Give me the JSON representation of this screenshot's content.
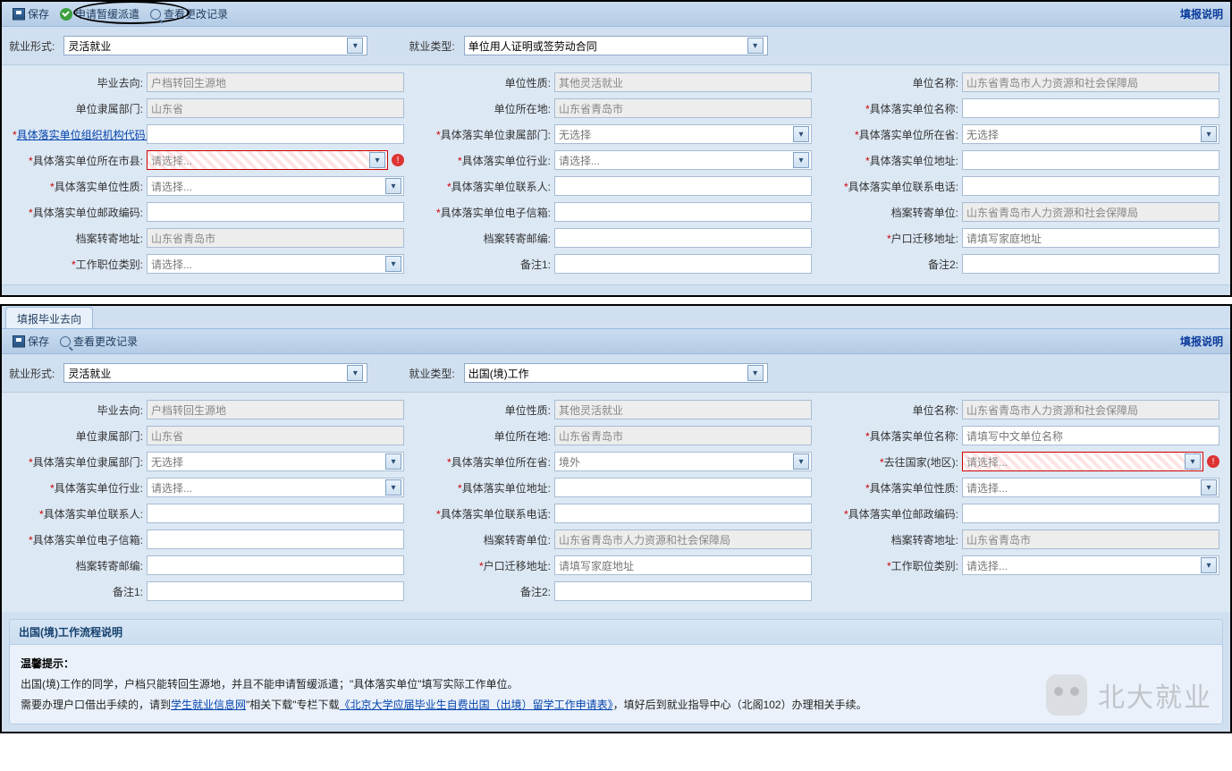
{
  "panel1": {
    "toolbar": {
      "save": "保存",
      "apply": "申请暂缓派遣",
      "view": "查看更改记录",
      "help": "填报说明"
    },
    "top": {
      "form_label": "就业形式:",
      "form_value": "灵活就业",
      "type_label": "就业类型:",
      "type_value": "单位用人证明或签劳动合同"
    },
    "rows": [
      {
        "a": {
          "label": "毕业去向:",
          "value": "户档转回生源地",
          "readonly": true
        },
        "b": {
          "label": "单位性质:",
          "value": "其他灵活就业",
          "readonly": true
        },
        "c": {
          "label": "单位名称:",
          "value": "山东省青岛市人力资源和社会保障局",
          "readonly": true
        }
      },
      {
        "a": {
          "label": "单位隶属部门:",
          "value": "山东省",
          "readonly": true
        },
        "b": {
          "label": "单位所在地:",
          "value": "山东省青岛市",
          "readonly": true
        },
        "c": {
          "label": "具体落实单位名称:",
          "required": true,
          "value": ""
        }
      },
      {
        "a": {
          "label": "具体落实单位组织机构代码:",
          "link": true,
          "required": true,
          "value": ""
        },
        "b": {
          "label": "具体落实单位隶属部门:",
          "required": true,
          "value": "无选择",
          "dropdown": true
        },
        "c": {
          "label": "具体落实单位所在省:",
          "required": true,
          "value": "无选择",
          "dropdown": true
        }
      },
      {
        "a": {
          "label": "具体落实单位所在市县:",
          "required": true,
          "value": "请选择...",
          "dropdown": true,
          "error": true
        },
        "b": {
          "label": "具体落实单位行业:",
          "required": true,
          "value": "请选择...",
          "dropdown": true
        },
        "c": {
          "label": "具体落实单位地址:",
          "required": true,
          "value": ""
        }
      },
      {
        "a": {
          "label": "具体落实单位性质:",
          "required": true,
          "value": "请选择...",
          "dropdown": true
        },
        "b": {
          "label": "具体落实单位联系人:",
          "required": true,
          "value": ""
        },
        "c": {
          "label": "具体落实单位联系电话:",
          "required": true,
          "value": ""
        }
      },
      {
        "a": {
          "label": "具体落实单位邮政编码:",
          "required": true,
          "value": ""
        },
        "b": {
          "label": "具体落实单位电子信箱:",
          "required": true,
          "value": ""
        },
        "c": {
          "label": "档案转寄单位:",
          "value": "山东省青岛市人力资源和社会保障局",
          "readonly": true
        }
      },
      {
        "a": {
          "label": "档案转寄地址:",
          "value": "山东省青岛市",
          "readonly": true
        },
        "b": {
          "label": "档案转寄邮编:",
          "value": ""
        },
        "c": {
          "label": "户口迁移地址:",
          "required": true,
          "value": "请填写家庭地址"
        }
      },
      {
        "a": {
          "label": "工作职位类别:",
          "required": true,
          "value": "请选择...",
          "dropdown": true
        },
        "b": {
          "label": "备注1:",
          "value": ""
        },
        "c": {
          "label": "备注2:",
          "value": ""
        }
      }
    ]
  },
  "panel2": {
    "tab": "填报毕业去向",
    "toolbar": {
      "save": "保存",
      "view": "查看更改记录",
      "help": "填报说明"
    },
    "top": {
      "form_label": "就业形式:",
      "form_value": "灵活就业",
      "type_label": "就业类型:",
      "type_value": "出国(境)工作"
    },
    "rows": [
      {
        "a": {
          "label": "毕业去向:",
          "value": "户档转回生源地",
          "readonly": true
        },
        "b": {
          "label": "单位性质:",
          "value": "其他灵活就业",
          "readonly": true
        },
        "c": {
          "label": "单位名称:",
          "value": "山东省青岛市人力资源和社会保障局",
          "readonly": true
        }
      },
      {
        "a": {
          "label": "单位隶属部门:",
          "value": "山东省",
          "readonly": true
        },
        "b": {
          "label": "单位所在地:",
          "value": "山东省青岛市",
          "readonly": true
        },
        "c": {
          "label": "具体落实单位名称:",
          "required": true,
          "value": "请填写中文单位名称"
        }
      },
      {
        "a": {
          "label": "具体落实单位隶属部门:",
          "required": true,
          "value": "无选择",
          "dropdown": true
        },
        "b": {
          "label": "具体落实单位所在省:",
          "required": true,
          "value": "境外",
          "dropdown": true
        },
        "c": {
          "label": "去往国家(地区):",
          "required": true,
          "value": "请选择...",
          "dropdown": true,
          "error": true
        }
      },
      {
        "a": {
          "label": "具体落实单位行业:",
          "required": true,
          "value": "请选择...",
          "dropdown": true
        },
        "b": {
          "label": "具体落实单位地址:",
          "required": true,
          "value": ""
        },
        "c": {
          "label": "具体落实单位性质:",
          "required": true,
          "value": "请选择...",
          "dropdown": true
        }
      },
      {
        "a": {
          "label": "具体落实单位联系人:",
          "required": true,
          "value": ""
        },
        "b": {
          "label": "具体落实单位联系电话:",
          "required": true,
          "value": ""
        },
        "c": {
          "label": "具体落实单位邮政编码:",
          "required": true,
          "value": ""
        }
      },
      {
        "a": {
          "label": "具体落实单位电子信箱:",
          "required": true,
          "value": ""
        },
        "b": {
          "label": "档案转寄单位:",
          "value": "山东省青岛市人力资源和社会保障局",
          "readonly": true
        },
        "c": {
          "label": "档案转寄地址:",
          "value": "山东省青岛市",
          "readonly": true
        }
      },
      {
        "a": {
          "label": "档案转寄邮编:",
          "value": ""
        },
        "b": {
          "label": "户口迁移地址:",
          "required": true,
          "value": "请填写家庭地址"
        },
        "c": {
          "label": "工作职位类别:",
          "required": true,
          "value": "请选择...",
          "dropdown": true
        }
      },
      {
        "a": {
          "label": "备注1:",
          "value": ""
        },
        "b": {
          "label": "备注2:",
          "value": ""
        },
        "c": null
      }
    ],
    "info": {
      "title": "出国(境)工作流程说明",
      "tip_label": "温馨提示：",
      "line1a": "出国(境)工作的同学，户档只能转回生源地，并且不能申请暂缓派遣；\"具体落实单位\"填写实际工作单位。",
      "line2a": "需要办理户口借出手续的，请到",
      "link1": "学生就业信息网",
      "line2b": "\"相关下载\"专栏下载",
      "link2": "《北京大学应届毕业生自费出国（出境）留学工作申请表》",
      "line2c": "，填好后到就业指导中心（北阁102）办理相关手续。"
    }
  },
  "watermark": "北大就业"
}
